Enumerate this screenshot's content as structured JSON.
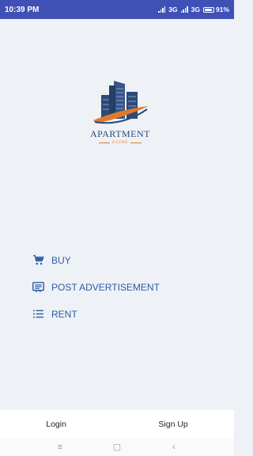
{
  "status": {
    "time": "10:39 PM",
    "network_1": "3G",
    "network_2": "3G",
    "battery": "91%",
    "battery_level": 0.91
  },
  "logo": {
    "title": "APARTMENT",
    "subtitle": "GUIDE",
    "colors": {
      "navy": "#2c4a78",
      "orange": "#e2782a"
    }
  },
  "menu": {
    "items": [
      {
        "label": "BUY",
        "icon": "cart-icon"
      },
      {
        "label": "POST ADVERTISEMENT",
        "icon": "notice-board-icon"
      },
      {
        "label": "RENT",
        "icon": "list-icon"
      }
    ]
  },
  "auth": {
    "login_label": "Login",
    "signup_label": "Sign Up"
  },
  "nav": {
    "menu_glyph": "≡",
    "home_glyph": "▢",
    "back_glyph": "‹"
  },
  "colors": {
    "status_bar": "#3f51b5",
    "accent": "#2d5ba8",
    "background": "#eef1f5"
  }
}
